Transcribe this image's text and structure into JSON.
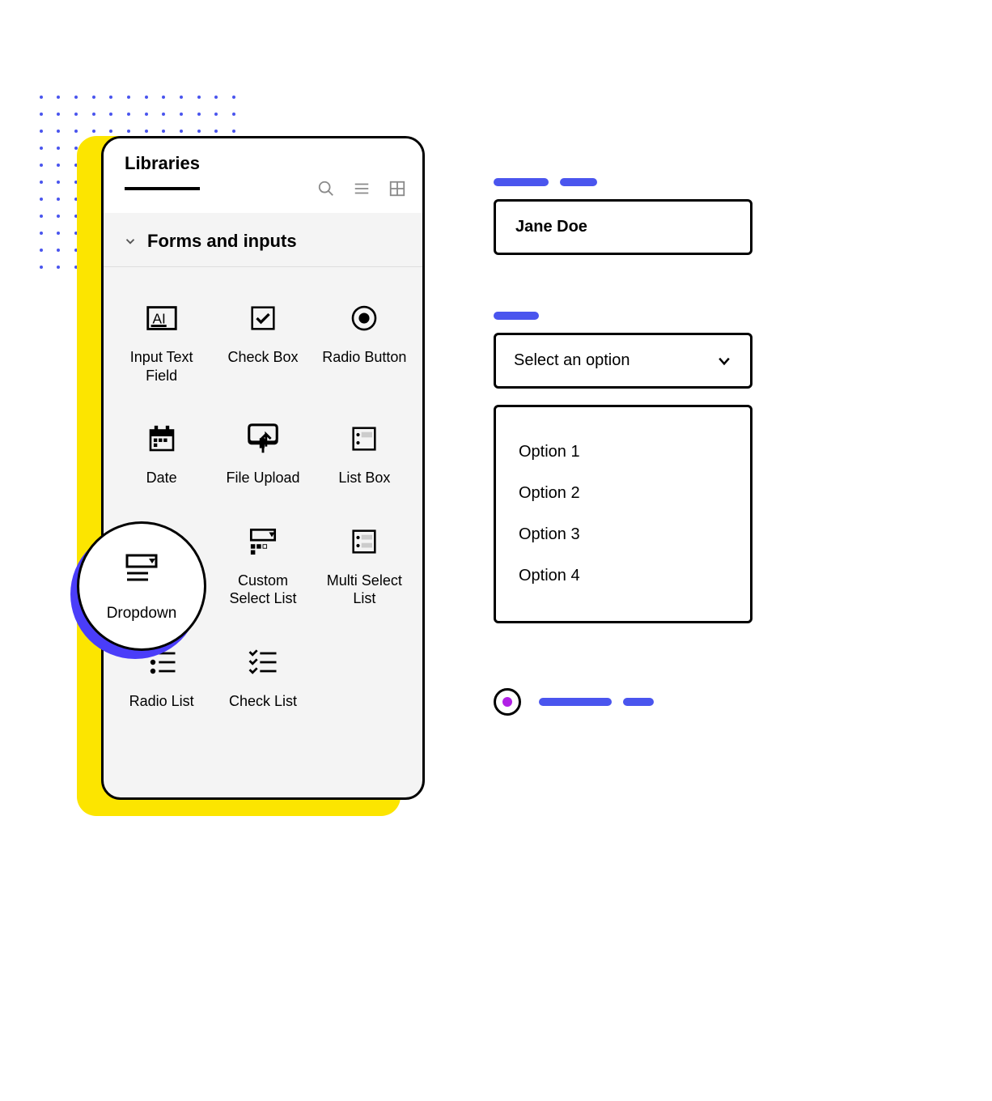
{
  "panel": {
    "title": "Libraries",
    "section_title": "Forms and inputs",
    "items": [
      {
        "label": "Input Text Field",
        "icon": "input-text-field-icon"
      },
      {
        "label": "Check Box",
        "icon": "checkbox-icon"
      },
      {
        "label": "Radio Button",
        "icon": "radio-button-icon"
      },
      {
        "label": "Date",
        "icon": "date-icon"
      },
      {
        "label": "File Upload",
        "icon": "file-upload-icon"
      },
      {
        "label": "List Box",
        "icon": "list-box-icon"
      },
      {
        "label": "Dropdown",
        "icon": "dropdown-icon"
      },
      {
        "label": "Custom Select List",
        "icon": "custom-select-list-icon"
      },
      {
        "label": "Multi Select List",
        "icon": "multi-select-list-icon"
      },
      {
        "label": "Radio List",
        "icon": "radio-list-icon"
      },
      {
        "label": "Check List",
        "icon": "check-list-icon"
      }
    ]
  },
  "highlight_label": "Dropdown",
  "text_input": {
    "value": "Jane Doe"
  },
  "select": {
    "placeholder": "Select an option",
    "options": [
      "Option 1",
      "Option 2",
      "Option 3",
      "Option 4"
    ]
  },
  "colors": {
    "accent_blue": "#4a55ee",
    "highlight_yellow": "#fce500",
    "radio_purple": "#b120e6"
  }
}
